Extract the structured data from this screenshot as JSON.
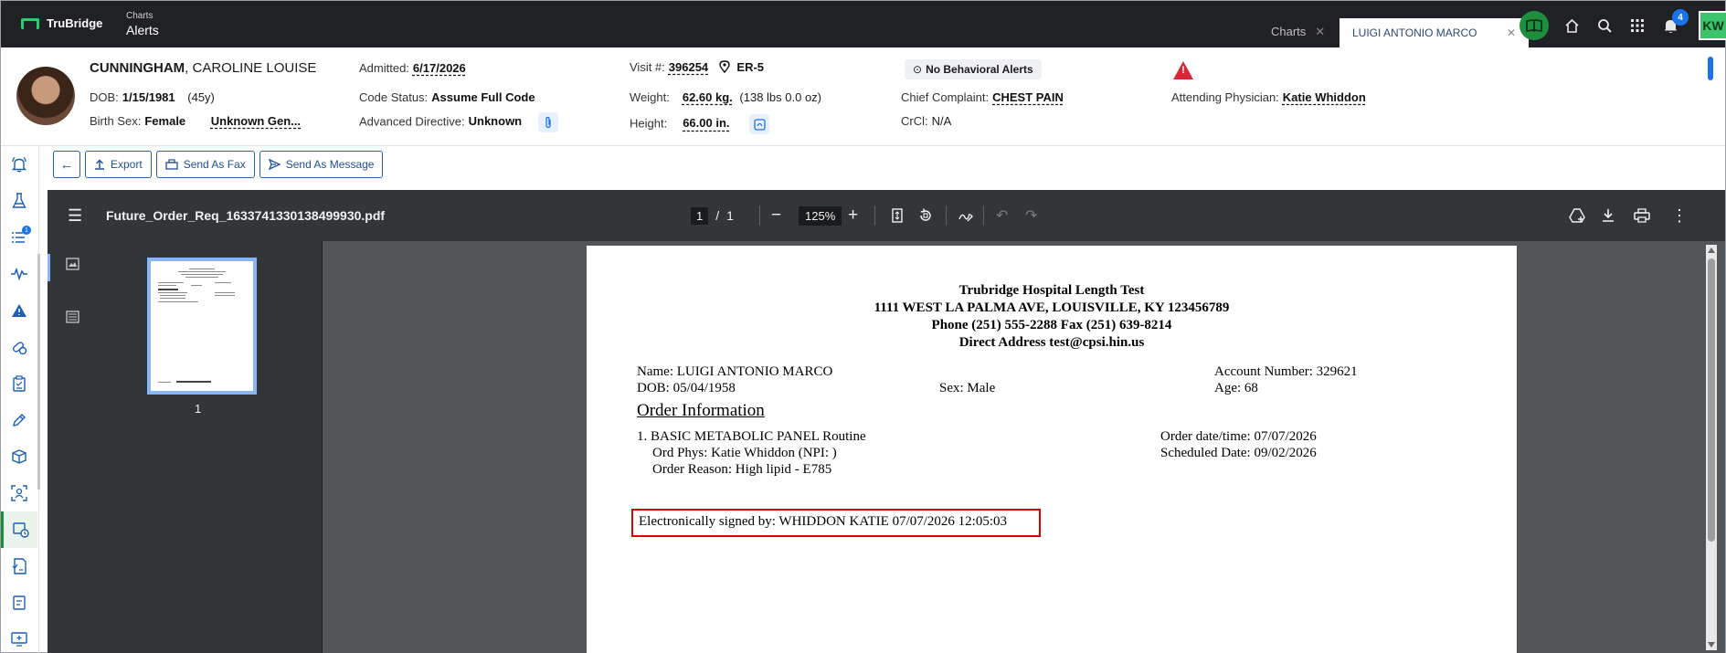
{
  "app": {
    "brand": "TruBridge",
    "crumb_small": "Charts",
    "crumb_title": "Alerts"
  },
  "tabs": [
    {
      "label": "Charts",
      "close": "✕"
    },
    {
      "label": "LUIGI ANTONIO MARCO",
      "close": "✕"
    }
  ],
  "topbar": {
    "notification_count": "4",
    "user_initials": "KW"
  },
  "patient": {
    "last_name": "CUNNINGHAM",
    "first_names": ", CAROLINE LOUISE",
    "dob_label": "DOB:",
    "dob": "1/15/1981",
    "age": "(45y)",
    "birth_sex_label": "Birth Sex:",
    "birth_sex": "Female",
    "gender": "Unknown Gen...",
    "admitted_label": "Admitted:",
    "admitted": "6/17/2026",
    "code_status_label": "Code Status:",
    "code_status": "Assume Full Code",
    "adv_directive_label": "Advanced Directive:",
    "adv_directive": "Unknown",
    "visit_label": "Visit #:",
    "visit": "396254",
    "location": "ER-5",
    "weight_label": "Weight:",
    "weight": "62.60 kg.",
    "weight_alt": "(138 lbs 0.0 oz)",
    "height_label": "Height:",
    "height": "66.00 in.",
    "behavioral": "No Behavioral Alerts",
    "complaint_label": "Chief Complaint:",
    "complaint": "CHEST PAIN",
    "crcl_label": "CrCl:",
    "crcl": "N/A",
    "physician_label": "Attending Physician:",
    "physician": "Katie Whiddon"
  },
  "actions": {
    "export": "Export",
    "fax": "Send As Fax",
    "message": "Send As Message"
  },
  "viewer": {
    "filename": "Future_Order_Req_1633741330138499930.pdf",
    "page_current": "1",
    "page_sep": "/",
    "page_total": "1",
    "zoom": "125%",
    "thumb_label": "1"
  },
  "document": {
    "hospital": "Trubridge Hospital Length Test",
    "address": "1111 WEST LA PALMA AVE, LOUISVILLE, KY 123456789",
    "phone": "Phone (251) 555-2288 Fax (251) 639-8214",
    "direct": "Direct Address test@cpsi.hin.us",
    "name": "Name: LUIGI ANTONIO MARCO",
    "dob": "DOB: 05/04/1958",
    "sex": "Sex: Male",
    "account": "Account Number: 329621",
    "age": "Age: 68",
    "section_title": "Order Information",
    "order_line": "1. BASIC METABOLIC PANEL Routine",
    "ord_phys": "Ord Phys: Katie Whiddon (NPI: )",
    "order_reason": "Order Reason: High lipid - E785",
    "order_datetime": "Order date/time: 07/07/2026",
    "scheduled": "Scheduled Date: 09/02/2026",
    "signature": "Electronically signed by: WHIDDON KATIE 07/07/2026 12:05:03"
  }
}
